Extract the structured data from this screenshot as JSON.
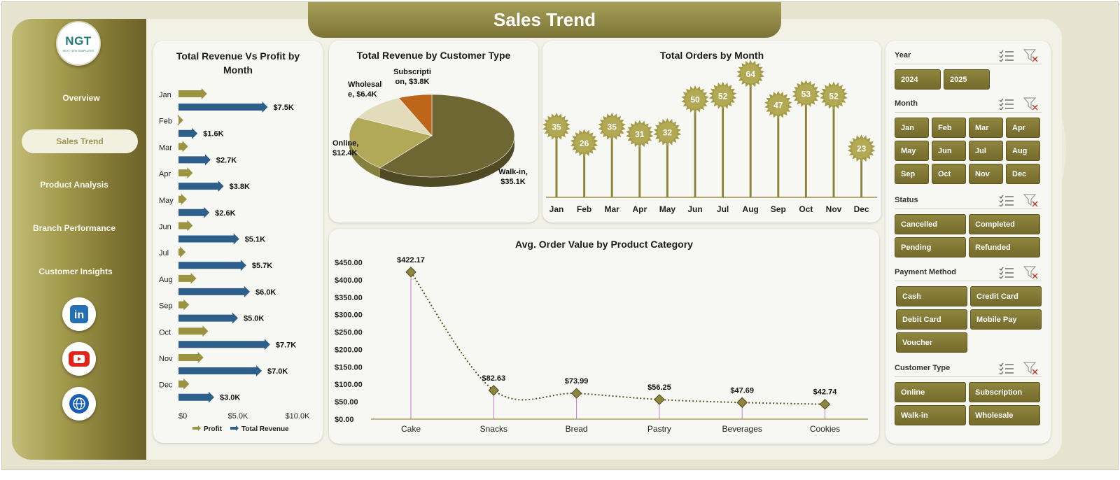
{
  "title": "Sales Trend",
  "logo": {
    "text": "NGT",
    "subtext": "NEXT GEN TEMPLATES"
  },
  "sidebar": {
    "items": [
      {
        "label": "Overview",
        "active": false
      },
      {
        "label": "Sales Trend",
        "active": true
      },
      {
        "label": "Product Analysis",
        "active": false
      },
      {
        "label": "Branch Performance",
        "active": false
      },
      {
        "label": "Customer Insights",
        "active": false
      }
    ],
    "social": [
      {
        "icon": "linkedin-icon",
        "text": "in"
      },
      {
        "icon": "youtube-icon"
      },
      {
        "icon": "web-icon"
      }
    ]
  },
  "charts": {
    "revenue_profit": {
      "title": "Total Revenue Vs Profit by Month"
    },
    "customer_type": {
      "title": "Total Revenue by Customer Type"
    },
    "orders": {
      "title": "Total Orders by Month"
    },
    "avg_order": {
      "title": "Avg. Order Value by Product Category"
    }
  },
  "chart_data": [
    {
      "type": "bar",
      "title": "Total Revenue Vs Profit by Month",
      "orientation": "horizontal",
      "categories": [
        "Jan",
        "Feb",
        "Mar",
        "Apr",
        "May",
        "Jun",
        "Jul",
        "Aug",
        "Sep",
        "Oct",
        "Nov",
        "Dec"
      ],
      "series": [
        {
          "name": "Profit",
          "values": [
            2.4,
            0.4,
            0.8,
            1.2,
            0.7,
            1.2,
            0.6,
            1.5,
            0.9,
            2.5,
            2.1,
            0.9
          ]
        },
        {
          "name": "Total Revenue",
          "values": [
            7.5,
            1.6,
            2.7,
            3.8,
            2.6,
            5.1,
            5.7,
            6.0,
            5.0,
            7.7,
            7.0,
            3.0
          ]
        }
      ],
      "data_labels": [
        "$7.5K",
        "$1.6K",
        "$2.7K",
        "$3.8K",
        "$2.6K",
        "$5.1K",
        "$5.7K",
        "$6.0K",
        "$5.0K",
        "$7.7K",
        "$7.0K",
        "$3.0K"
      ],
      "x_ticks": [
        "$0",
        "$5.0K",
        "$10.0K"
      ],
      "xlim": [
        0,
        10
      ],
      "legend": "bottom",
      "colors": {
        "Profit": "#9c9340",
        "Total Revenue": "#2e5f8a"
      }
    },
    {
      "type": "pie",
      "title": "Total Revenue by Customer Type",
      "labels": [
        "Walk-in",
        "Online",
        "Wholesale",
        "Subscription"
      ],
      "values": [
        35.1,
        12.4,
        6.4,
        3.8
      ],
      "data_labels": [
        "Walk-in,\n$35.1K",
        "Online,\n$12.4K",
        "Wholesal\ne, $6.4K",
        "Subscripti\non, $3.8K"
      ],
      "colors": [
        "#6e6733",
        "#b1a957",
        "#e3dcba",
        "#bd661a"
      ]
    },
    {
      "type": "bar",
      "title": "Total Orders by Month",
      "categories": [
        "Jan",
        "Feb",
        "Mar",
        "Apr",
        "May",
        "Jun",
        "Jul",
        "Aug",
        "Sep",
        "Oct",
        "Nov",
        "Dec"
      ],
      "values": [
        35,
        26,
        35,
        31,
        32,
        50,
        52,
        64,
        47,
        53,
        52,
        23
      ],
      "style": "lollipop-starburst"
    },
    {
      "type": "line",
      "title": "Avg. Order Value by Product Category",
      "categories": [
        "Cake",
        "Snacks",
        "Bread",
        "Pastry",
        "Beverages",
        "Cookies"
      ],
      "values": [
        422.17,
        82.63,
        73.99,
        56.25,
        47.69,
        42.74
      ],
      "data_labels": [
        "$422.17",
        "$82.63",
        "$73.99",
        "$56.25",
        "$47.69",
        "$42.74"
      ],
      "y_ticks": [
        "$0.00",
        "$50.00",
        "$100.00",
        "$150.00",
        "$200.00",
        "$250.00",
        "$300.00",
        "$350.00",
        "$400.00",
        "$450.00"
      ],
      "ylim": [
        0,
        450
      ]
    }
  ],
  "filters": {
    "year": {
      "label": "Year",
      "options": [
        "2024",
        "2025"
      ]
    },
    "month": {
      "label": "Month",
      "options": [
        "Jan",
        "Feb",
        "Mar",
        "Apr",
        "May",
        "Jun",
        "Jul",
        "Aug",
        "Sep",
        "Oct",
        "Nov",
        "Dec"
      ]
    },
    "status": {
      "label": "Status",
      "options": [
        "Cancelled",
        "Completed",
        "Pending",
        "Refunded"
      ]
    },
    "payment": {
      "label": "Payment Method",
      "options": [
        "Cash",
        "Credit Card",
        "Debit Card",
        "Mobile Pay",
        "Voucher"
      ]
    },
    "customer": {
      "label": "Customer Type",
      "options": [
        "Online",
        "Subscription",
        "Walk-in",
        "Wholesale"
      ]
    }
  }
}
